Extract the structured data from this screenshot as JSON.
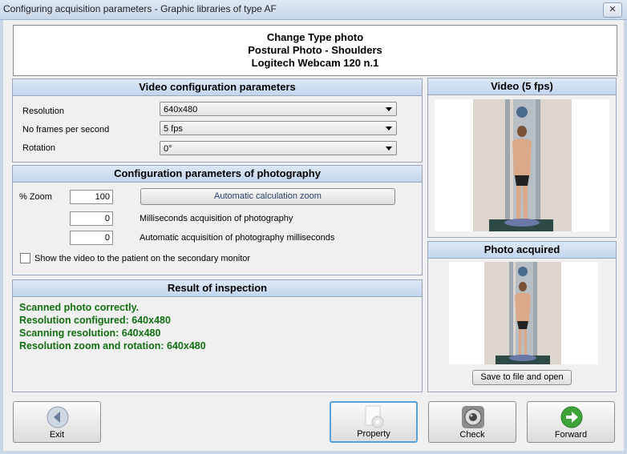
{
  "window": {
    "title": "Configuring acquisition parameters - Graphic libraries of type AF",
    "close_glyph": "✕"
  },
  "header": {
    "line1": "Change Type photo",
    "line2": "Postural Photo - Shoulders",
    "line3": "Logitech Webcam 120 n.1"
  },
  "video_config": {
    "title": "Video configuration parameters",
    "resolution_label": "Resolution",
    "resolution_value": "640x480",
    "fps_label": "No frames per second",
    "fps_value": "5 fps",
    "rotation_label": "Rotation",
    "rotation_value": "0°"
  },
  "photo_config": {
    "title": "Configuration parameters of photography",
    "zoom_label": "% Zoom",
    "zoom_value": "100",
    "auto_zoom_button": "Automatic calculation zoom",
    "ms_value": "0",
    "ms_label": "Milliseconds acquisition of photography",
    "auto_ms_value": "0",
    "auto_ms_label": "Automatic acquisition of photography milliseconds",
    "secondary_monitor_label": "Show the video to the patient on the secondary monitor"
  },
  "result": {
    "title": "Result of inspection",
    "lines": [
      "Scanned photo correctly.",
      "Resolution configured: 640x480",
      "Scanning resolution: 640x480",
      "Resolution zoom and rotation: 640x480"
    ]
  },
  "video_panel": {
    "title": "Video (5 fps)"
  },
  "photo_panel": {
    "title": "Photo acquired",
    "save_button": "Save to file and open"
  },
  "buttons": {
    "exit": "Exit",
    "property": "Property",
    "check": "Check",
    "forward": "Forward"
  },
  "colors": {
    "result_text": "#107010",
    "panel_header": "#c3d6ee",
    "forward_icon": "#3ea43a"
  },
  "icons": {
    "exit": "back-arrow-icon",
    "property": "gear-document-icon",
    "check": "webcam-icon",
    "forward": "forward-arrow-icon"
  }
}
